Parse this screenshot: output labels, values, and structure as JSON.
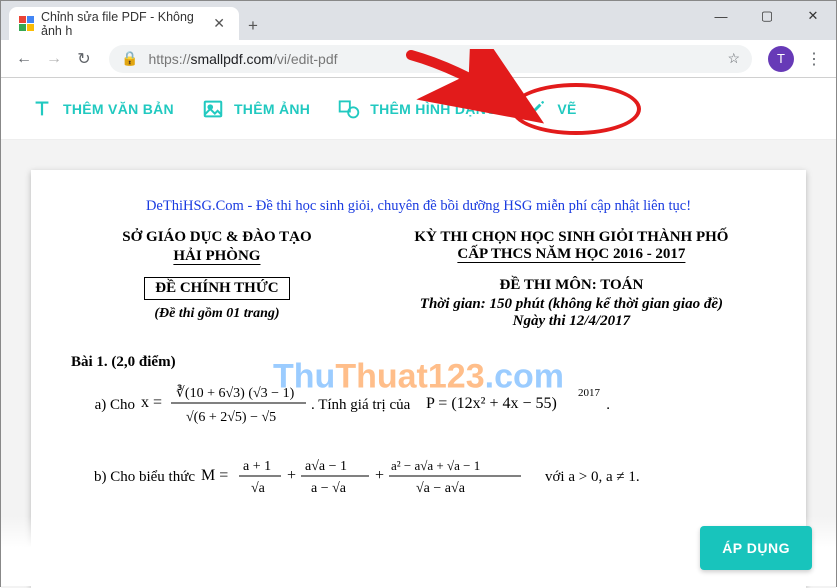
{
  "browser": {
    "tab_title": "Chỉnh sửa file PDF - Không ảnh h",
    "new_tab": "+",
    "win_min": "—",
    "win_max": "▢",
    "win_close": "✕",
    "back": "←",
    "forward": "→",
    "reload": "↻",
    "lock": "🔒",
    "url_prefix": "https://",
    "url_host": "smallpdf.com",
    "url_path": "/vi/edit-pdf",
    "star": "☆",
    "avatar_letter": "T",
    "kebab": "⋮"
  },
  "toolbar": {
    "text_label": "THÊM VĂN BẢN",
    "image_label": "THÊM ẢNH",
    "shape_label": "THÊM HÌNH DẠNG",
    "draw_label": "VẼ"
  },
  "watermark": {
    "p1": "Thu",
    "p2": "Thuat",
    "p3": "123",
    "dot": ".",
    "p4": "com"
  },
  "document": {
    "banner": "DeThiHSG.Com - Đề thi học sinh giỏi, chuyên đề bồi dưỡng HSG miễn phí cập nhật liên tục!",
    "left_line1": "SỞ GIÁO DỤC & ĐÀO TẠO",
    "left_city": "HẢI PHÒNG",
    "de_chinh": "ĐỀ CHÍNH THỨC",
    "sub_left": "(Đề thi gồm 01 trang)",
    "right_line1": "KỲ THI CHỌN HỌC SINH GIỎI THÀNH PHỐ",
    "right_line2": "CẤP THCS NĂM HỌC 2016 - 2017",
    "subject": "ĐỀ THI MÔN: TOÁN",
    "duration": "Thời gian: 150  phút (không kể thời gian giao đề)",
    "date": "Ngày thi 12/4/2017",
    "bai1": "Bài 1. (2,0 điểm)",
    "a_label": "a) Cho",
    "a_tail": ".  Tính giá trị của",
    "p_tail": ".",
    "b_label": "b) Cho biểu thức",
    "b_tail": "với a > 0, a ≠ 1."
  },
  "apply_label": "ÁP DỤNG",
  "colors": {
    "accent": "#21c9c0",
    "banner_link": "#1a3be0",
    "highlight_ring": "#e21b1b"
  }
}
